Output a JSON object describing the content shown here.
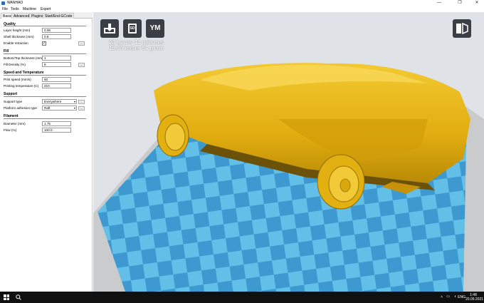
{
  "window": {
    "title": "WANHAO",
    "minimize": "—",
    "maximize": "❐",
    "close": "✕"
  },
  "menu": [
    "File",
    "Tools",
    "Machine",
    "Expert"
  ],
  "tabs": [
    "Basic",
    "Advanced",
    "Plugins",
    "Start/End-GCode"
  ],
  "sections": {
    "quality": {
      "title": "Quality",
      "layer_height": {
        "label": "Layer height (mm)",
        "value": "0.06"
      },
      "shell_thickness": {
        "label": "Shell thickness (mm)",
        "value": "0.8"
      },
      "retraction": {
        "label": "Enable retraction",
        "checked": "✓",
        "more": "..."
      }
    },
    "fill": {
      "title": "Fill",
      "bottom_top": {
        "label": "Bottom/Top thickness (mm)",
        "value": "1"
      },
      "density": {
        "label": "Fill Density (%)",
        "value": "8",
        "more": "..."
      }
    },
    "speed": {
      "title": "Speed and Temperature",
      "print_speed": {
        "label": "Print speed (mm/s)",
        "value": "50"
      },
      "print_temp": {
        "label": "Printing temperature (C)",
        "value": "210"
      }
    },
    "support": {
      "title": "Support",
      "support_type": {
        "label": "Support type",
        "value": "Everywhere",
        "more": "..."
      },
      "adhesion": {
        "label": "Platform adhesion type",
        "value": "Raft",
        "more": "..."
      }
    },
    "filament": {
      "title": "Filament",
      "diameter": {
        "label": "Diameter (mm)",
        "value": "1.75"
      },
      "flow": {
        "label": "Flow (%)",
        "value": "100.0"
      }
    }
  },
  "viewport": {
    "buttons": {
      "load": "load-icon",
      "sd": "SD",
      "ym": "YM"
    },
    "stats_line1": "23 hours 44 minutes",
    "stats_line2": "18.30 meter 54 gram",
    "model_color": "#e6b615",
    "bed_tile_light": "#62bfe7",
    "bed_tile_dark": "#3d99cf"
  },
  "taskbar": {
    "lang": "ENG",
    "time": "1:48",
    "date": "20.09.2021"
  }
}
